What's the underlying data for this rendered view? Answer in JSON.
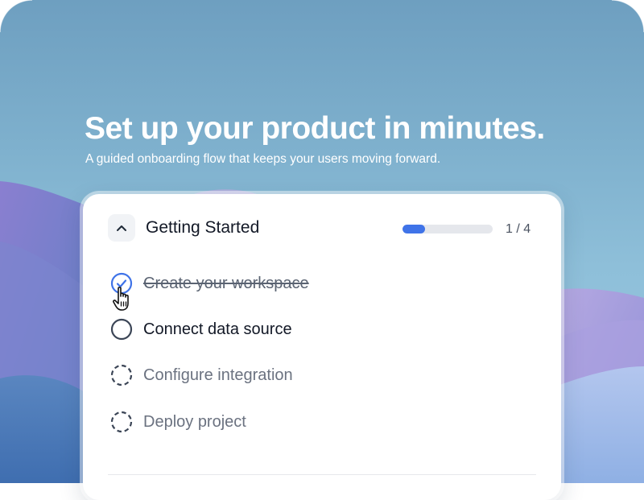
{
  "hero": {
    "title": "Set up your product in minutes.",
    "subtitle": "A guided onboarding flow that keeps your users moving forward."
  },
  "card": {
    "title": "Getting Started",
    "progress_text": "1 / 4",
    "progress_fraction": 0.25,
    "collapse_icon": "chevron-up-icon",
    "tasks": [
      {
        "label": "Create your workspace",
        "status": "completed",
        "icon": "check-circle-icon"
      },
      {
        "label": "Connect data source",
        "status": "current",
        "icon": "circle-icon"
      },
      {
        "label": "Configure integration",
        "status": "pending",
        "icon": "dashed-circle-icon"
      },
      {
        "label": "Deploy project",
        "status": "pending",
        "icon": "dashed-circle-icon"
      }
    ]
  },
  "colors": {
    "accent": "#3f73e8",
    "track": "#e5e7ec",
    "card_bg": "#ffffff",
    "text_primary": "#121826",
    "text_muted": "#6b7280"
  }
}
